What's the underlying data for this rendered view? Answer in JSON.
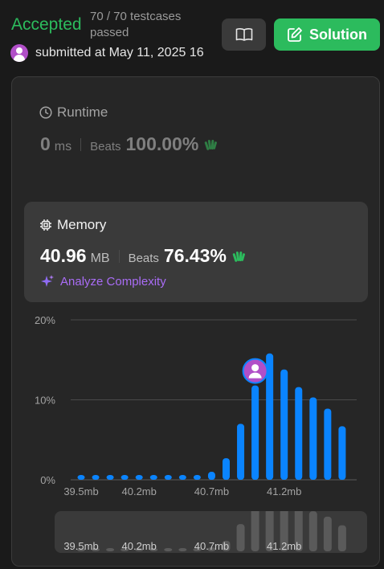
{
  "header": {
    "status": "Accepted",
    "testcases": "70 / 70 testcases passed",
    "submitted": "submitted at May 11, 2025 16",
    "solution_label": "Solution"
  },
  "icons": {
    "book": "book-icon",
    "edit": "edit-icon",
    "clock": "clock-icon",
    "chip": "chip-icon",
    "sparkle": "sparkle-icon",
    "clap": "clap-icon",
    "avatar": "user-avatar"
  },
  "colors": {
    "accepted": "#2cbb5d",
    "bar": "#0a84ff",
    "bar_dim": "#5a5a5a",
    "analyze": "#a96cf5",
    "avatar": "#b14fc8"
  },
  "runtime": {
    "title": "Runtime",
    "value": "0",
    "unit": "ms",
    "beats_label": "Beats",
    "beats": "100.00%"
  },
  "memory": {
    "title": "Memory",
    "value": "40.96",
    "unit": "MB",
    "beats_label": "Beats",
    "beats": "76.43%",
    "analyze_label": "Analyze Complexity"
  },
  "chart_data": {
    "type": "bar",
    "xlabel": "",
    "ylabel": "",
    "ylim": [
      0,
      20
    ],
    "yticks": [
      "0%",
      "10%",
      "20%"
    ],
    "xtick_labels": [
      "39.5mb",
      "40.2mb",
      "40.7mb",
      "41.2mb"
    ],
    "xtick_positions": [
      0,
      4,
      9,
      14
    ],
    "values": [
      0.6,
      0.6,
      0.6,
      0.6,
      0.6,
      0.6,
      0.6,
      0.6,
      0.6,
      1.0,
      2.7,
      7.0,
      11.8,
      15.8,
      13.8,
      11.6,
      10.3,
      8.9,
      6.7
    ],
    "user_bar_index": 12,
    "grid": true
  },
  "mini_chart": {
    "labels": [
      "39.5mb",
      "40.2mb",
      "40.7mb",
      "41.2mb"
    ]
  }
}
